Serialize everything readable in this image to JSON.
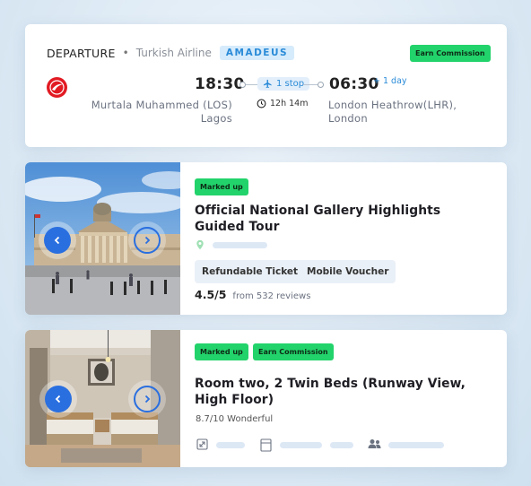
{
  "flight": {
    "label": "DEPARTURE",
    "separator": "•",
    "airline": "Turkish Airline",
    "gds": "AMADEUS",
    "commission_badge": "Earn Commission",
    "depart_time": "18:30",
    "arrive_time": "06:30",
    "day_offset": "+ 1 day",
    "stops": "1 stop",
    "duration": "12h 14m",
    "origin_line1": "Murtala Muhammed (LOS)",
    "origin_line2": "Lagos",
    "dest_line1": "London Heathrow(LHR),",
    "dest_line2": "London",
    "colors": {
      "airline_brand": "#e21a22",
      "accent": "#2a8bd8",
      "badge": "#22d36b"
    }
  },
  "tour": {
    "badge": "Marked up",
    "title": "Official National Gallery Highlights Guided Tour",
    "tags": [
      "Refundable Ticket",
      "Mobile Voucher"
    ],
    "rating": "4.5/5",
    "reviews": "from 532 reviews",
    "icons": {
      "location": "location-pin-icon",
      "prev": "chevron-left-icon",
      "next": "chevron-right-icon"
    }
  },
  "hotel": {
    "badges": [
      "Marked up",
      "Earn Commission"
    ],
    "title": "Room two, 2 Twin Beds (Runway View, High Floor)",
    "score": "8.7/10 Wonderful",
    "icons": {
      "size": "expand-icon",
      "bed": "door-icon",
      "guests": "people-icon"
    }
  }
}
